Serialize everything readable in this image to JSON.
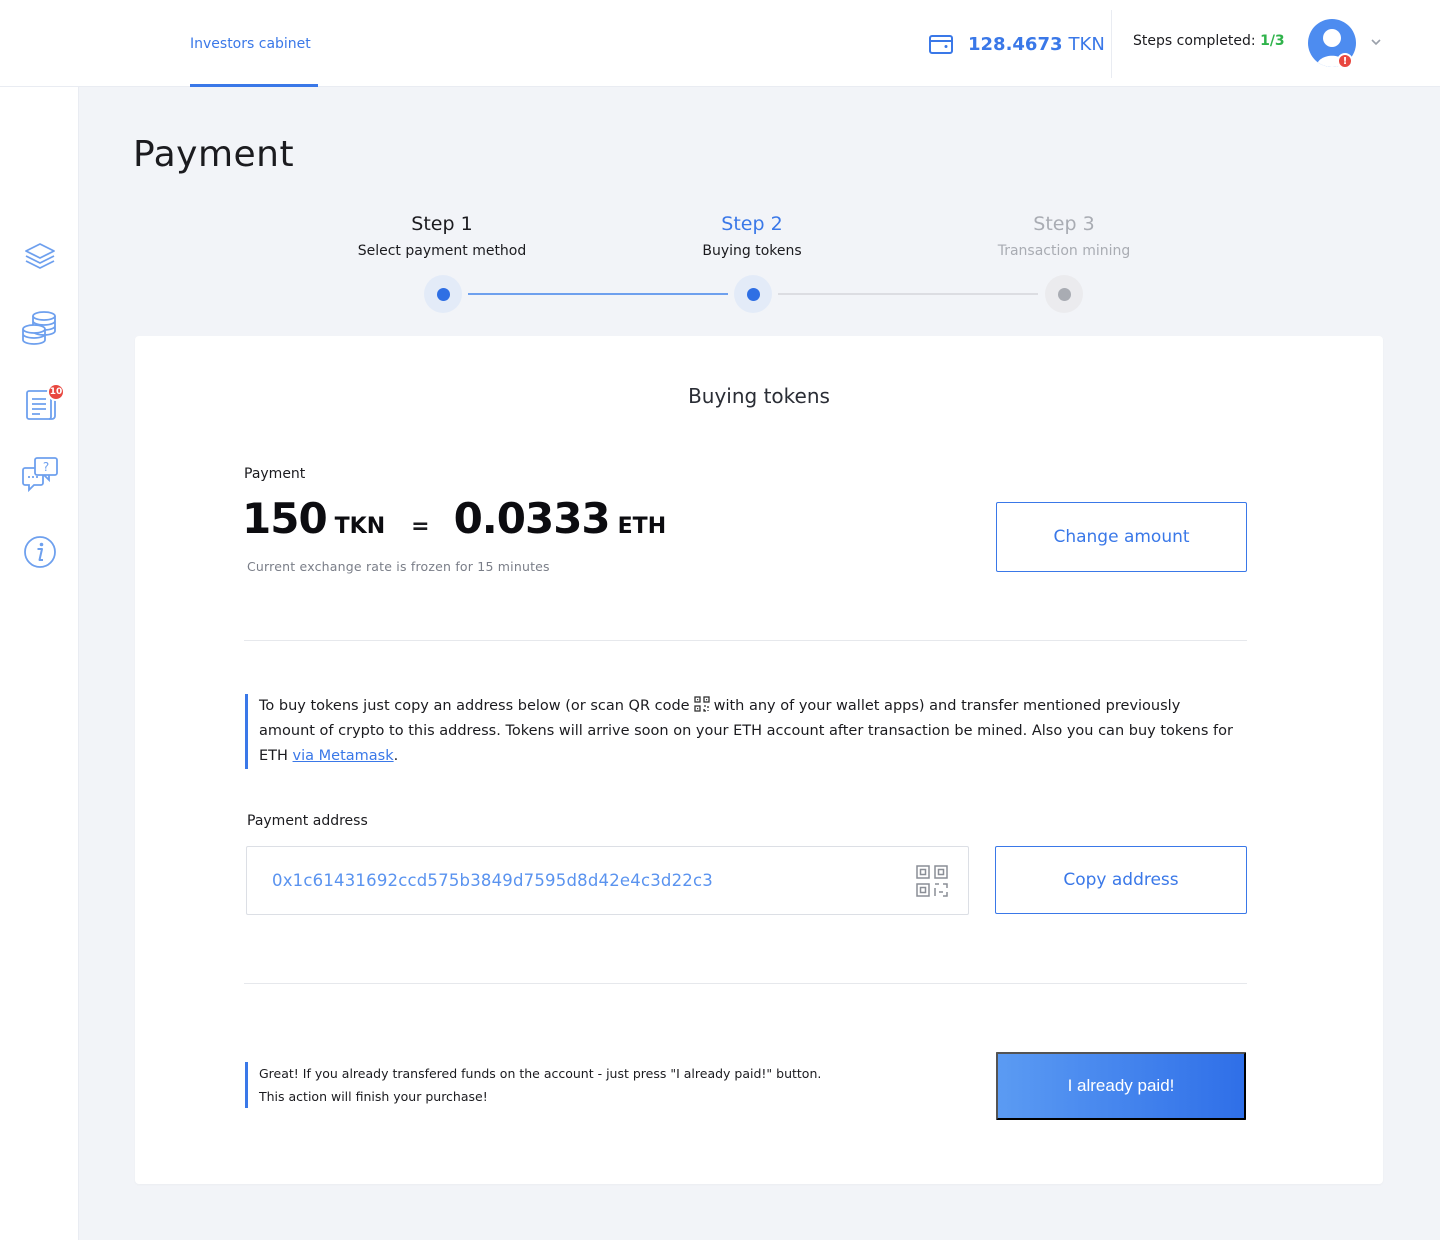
{
  "topbar": {
    "nav_tab": "Investors cabinet",
    "balance_amount": "128.4673",
    "balance_unit": "TKN",
    "steps_label": "Steps completed:",
    "steps_value": "1/3",
    "avatar_alert": "!"
  },
  "sidebar": {
    "items": [
      {
        "icon": "layers-icon"
      },
      {
        "icon": "coins-icon"
      },
      {
        "icon": "document-list-icon",
        "badge": "10"
      },
      {
        "icon": "chat-question-icon"
      },
      {
        "icon": "info-icon"
      }
    ]
  },
  "page": {
    "title": "Payment"
  },
  "stepper": {
    "steps": [
      {
        "title": "Step 1",
        "subtitle": "Select payment method",
        "state": "done"
      },
      {
        "title": "Step 2",
        "subtitle": "Buying tokens",
        "state": "active"
      },
      {
        "title": "Step 3",
        "subtitle": "Transaction mining",
        "state": "pending"
      }
    ]
  },
  "card": {
    "title": "Buying tokens",
    "payment_label": "Payment",
    "token_amount": "150",
    "token_unit": "TKN",
    "equals": "=",
    "eth_amount": "0.0333",
    "eth_unit": "ETH",
    "rate_note": "Current exchange rate is frozen for 15 minutes",
    "change_button": "Change amount",
    "info_text_1": "To buy tokens just copy an address below (or scan QR code",
    "info_text_2": "with any of your wallet apps) and transfer mentioned previously amount of crypto to this address. Tokens will arrive soon on your ETH account after transaction be mined. Also you can buy tokens for ETH",
    "info_link": "via Metamask",
    "info_end": ".",
    "address_label": "Payment address",
    "address_value": "0x1c61431692ccd575b3849d7595d8d42e4c3d22c3",
    "copy_button": "Copy address",
    "paid_note": "Great! If you already transfered funds on the account - just press \"I already paid!\" button. This action will finish your purchase!",
    "paid_button": "I already paid!"
  },
  "colors": {
    "accent": "#3a78e8",
    "success": "#2fb34b",
    "alert": "#e8473f"
  }
}
